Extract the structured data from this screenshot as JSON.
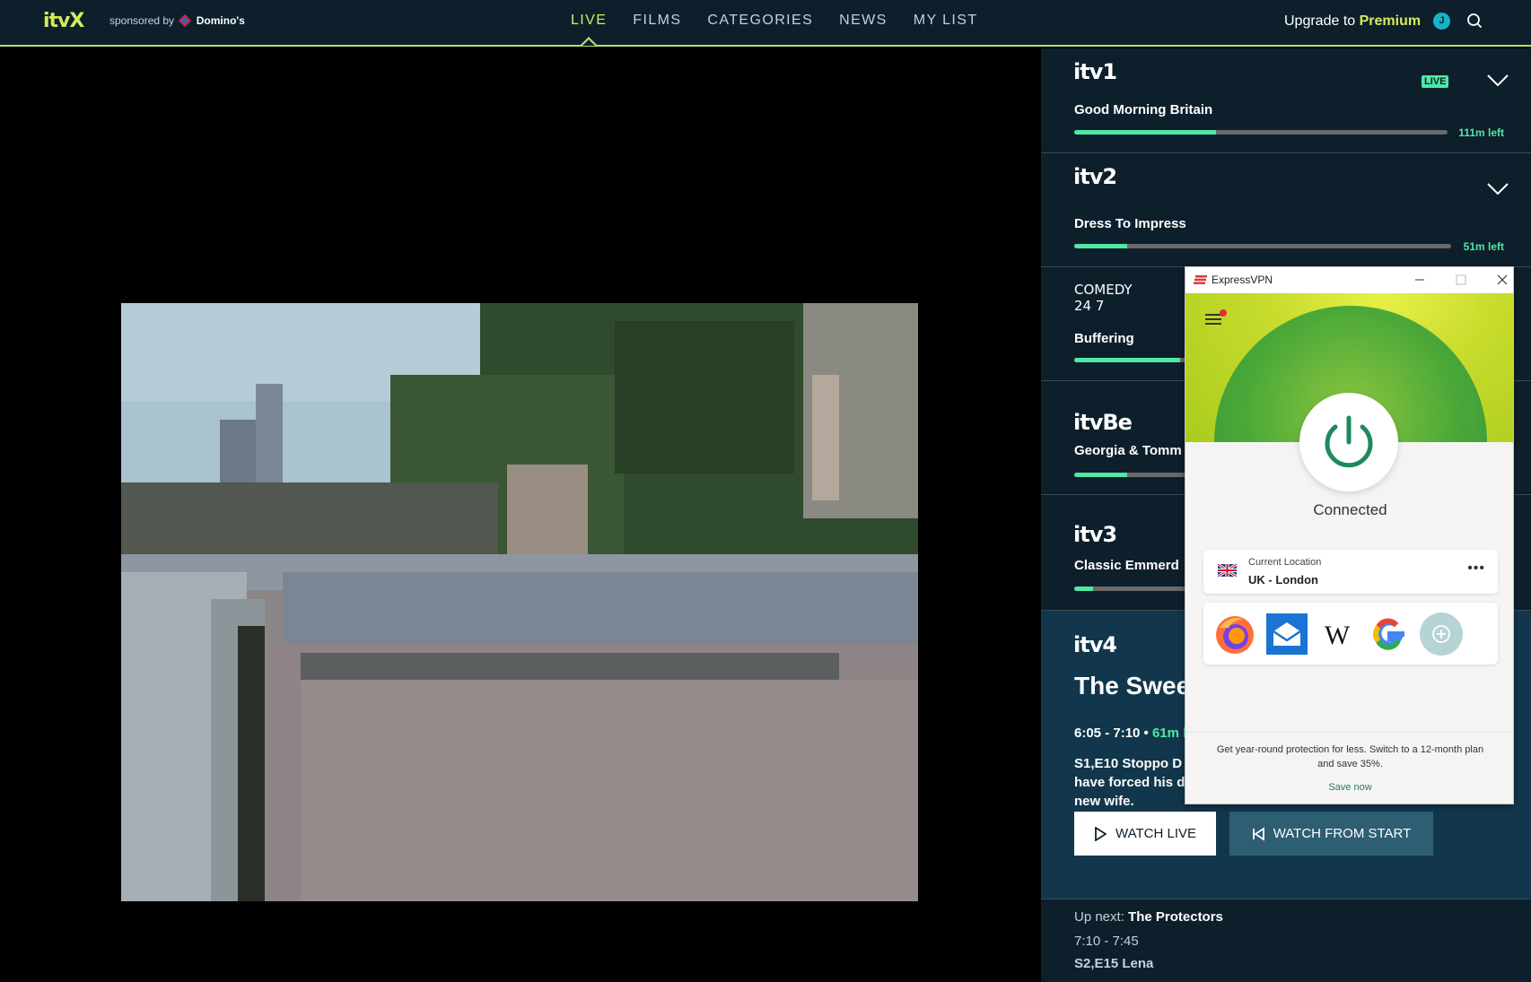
{
  "header": {
    "logo": "itvX",
    "sponsor_text": "sponsored by",
    "sponsor_name": "Domino's",
    "nav": [
      "LIVE",
      "FILMS",
      "CATEGORIES",
      "NEWS",
      "MY LIST"
    ],
    "active_nav": "LIVE",
    "upgrade_text": "Upgrade to",
    "upgrade_highlight": "Premium",
    "avatar_initial": "J",
    "accent_color": "#d4ec5a"
  },
  "channels": [
    {
      "logo": "itv1",
      "show": "Good Morning Britain",
      "progress": 0.38,
      "time_left": "111m left",
      "live_badge": "LIVE"
    },
    {
      "logo": "itv2",
      "show": "Dress To Impress",
      "progress": 0.14,
      "time_left": "51m left"
    },
    {
      "logo": "COMEDY 24 7",
      "show": "Buffering",
      "progress": 0.28
    },
    {
      "logo": "itvBe",
      "show": "Georgia & Tomm",
      "progress": 0.14
    },
    {
      "logo": "itv3",
      "show": "Classic Emmerd",
      "progress": 0.05
    }
  ],
  "featured": {
    "logo": "itv4",
    "title": "The Swee",
    "time": "6:05 - 7:10 •",
    "time_left": "61m l",
    "episode": "S1,E10 Stoppo D",
    "description_line2": "have forced his d",
    "description_line3": "new wife.",
    "watch_live_label": "WATCH LIVE",
    "watch_start_label": "WATCH FROM START",
    "up_next_label": "Up next:",
    "up_next_title": "The Protectors",
    "up_next_time": "7:10 - 7:45",
    "up_next_episode": "S2,E15 Lena"
  },
  "vpn": {
    "window_title": "ExpressVPN",
    "status": "Connected",
    "location_label": "Current Location",
    "location_value": "UK - London",
    "shortcuts": [
      "firefox-icon",
      "mail-icon",
      "wikipedia-icon",
      "google-icon",
      "add-shortcut-icon"
    ],
    "promo": "Get year-round protection for less. Switch to a 12-month plan and save 35%.",
    "save_label": "Save now"
  }
}
